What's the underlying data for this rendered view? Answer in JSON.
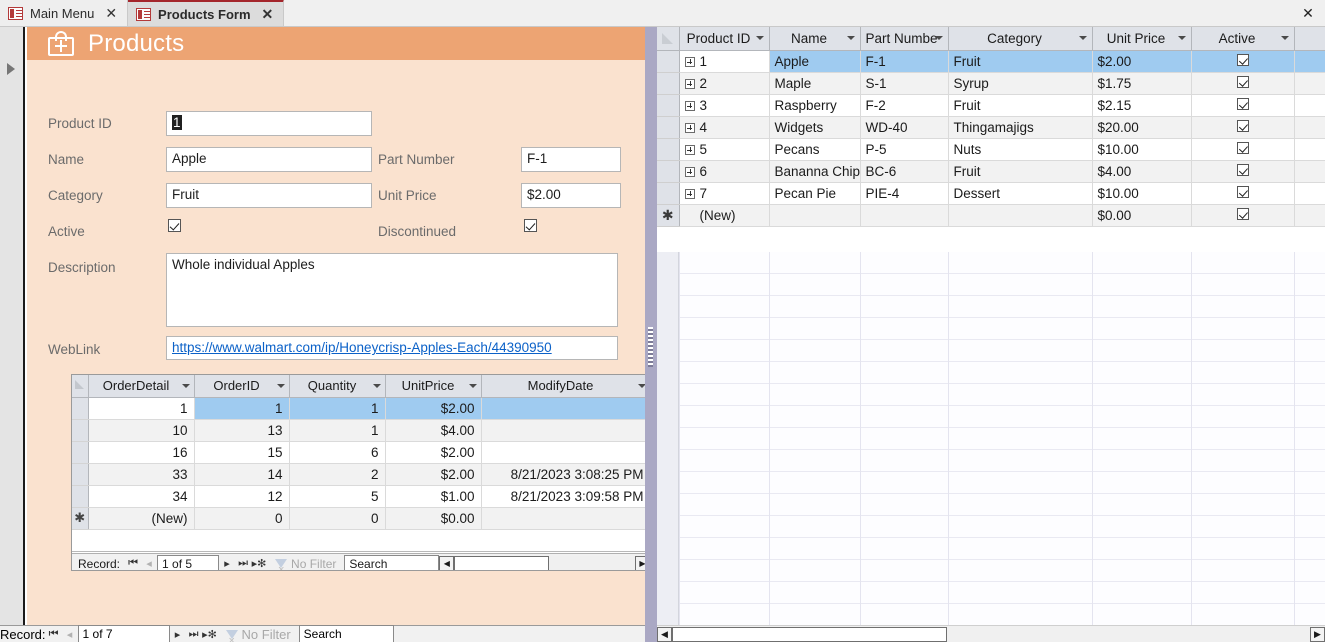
{
  "window": {
    "close_label": "✕"
  },
  "tabs": [
    {
      "label": "Main Menu",
      "close": "✕",
      "active": false
    },
    {
      "label": "Products Form",
      "close": "✕",
      "active": true
    }
  ],
  "form": {
    "title": "Products",
    "icon": "shopping-bag-plus-icon",
    "header_color": "#eda473",
    "body_color": "#fae2cf",
    "fields": {
      "product_id_label": "Product ID",
      "product_id_value": "1",
      "name_label": "Name",
      "name_value": "Apple",
      "part_number_label": "Part Number",
      "part_number_value": "F-1",
      "category_label": "Category",
      "category_value": "Fruit",
      "unit_price_label": "Unit Price",
      "unit_price_value": "$2.00",
      "active_label": "Active",
      "active_checked": true,
      "discontinued_label": "Discontinued",
      "discontinued_checked": true,
      "description_label": "Description",
      "description_value": "Whole individual Apples",
      "weblink_label": "WebLink",
      "weblink_value": "https://www.walmart.com/ip/Honeycrisp-Apples-Each/44390950"
    }
  },
  "subform": {
    "columns": [
      "OrderDetail",
      "OrderID",
      "Quantity",
      "UnitPrice",
      "ModifyDate"
    ],
    "rows": [
      {
        "OrderDetail": "1",
        "OrderID": "1",
        "Quantity": "1",
        "UnitPrice": "$2.00",
        "ModifyDate": "",
        "selected": true
      },
      {
        "OrderDetail": "10",
        "OrderID": "13",
        "Quantity": "1",
        "UnitPrice": "$4.00",
        "ModifyDate": "",
        "selected": false
      },
      {
        "OrderDetail": "16",
        "OrderID": "15",
        "Quantity": "6",
        "UnitPrice": "$2.00",
        "ModifyDate": "",
        "selected": false
      },
      {
        "OrderDetail": "33",
        "OrderID": "14",
        "Quantity": "2",
        "UnitPrice": "$2.00",
        "ModifyDate": "8/21/2023 3:08:25 PM",
        "selected": false
      },
      {
        "OrderDetail": "34",
        "OrderID": "12",
        "Quantity": "5",
        "UnitPrice": "$1.00",
        "ModifyDate": "8/21/2023 3:09:58 PM",
        "selected": false
      },
      {
        "OrderDetail": "(New)",
        "OrderID": "0",
        "Quantity": "0",
        "UnitPrice": "$0.00",
        "ModifyDate": "",
        "selected": false
      }
    ],
    "navbar": {
      "record_label": "Record:",
      "first": "⏮",
      "prev": "◂",
      "position": "1 of 5",
      "next": "▸",
      "last": "⏭",
      "new": "▸✻",
      "filter_label": "No Filter",
      "search_placeholder": "Search",
      "search_value": "Search"
    }
  },
  "datasheet": {
    "columns": [
      "Product ID",
      "Name",
      "Part Numbe",
      "Category",
      "Unit Price",
      "Active"
    ],
    "rows": [
      {
        "id": "1",
        "name": "Apple",
        "part": "F-1",
        "category": "Fruit",
        "price": "$2.00",
        "active": true,
        "selected": true,
        "expandable": true
      },
      {
        "id": "2",
        "name": "Maple",
        "part": "S-1",
        "category": "Syrup",
        "price": "$1.75",
        "active": true,
        "selected": false,
        "expandable": true
      },
      {
        "id": "3",
        "name": "Raspberry",
        "part": "F-2",
        "category": "Fruit",
        "price": "$2.15",
        "active": true,
        "selected": false,
        "expandable": true
      },
      {
        "id": "4",
        "name": "Widgets",
        "part": "WD-40",
        "category": "Thingamajigs",
        "price": "$20.00",
        "active": true,
        "selected": false,
        "expandable": true
      },
      {
        "id": "5",
        "name": "Pecans",
        "part": "P-5",
        "category": "Nuts",
        "price": "$10.00",
        "active": true,
        "selected": false,
        "expandable": true
      },
      {
        "id": "6",
        "name": "Bananna Chip",
        "part": "BC-6",
        "category": "Fruit",
        "price": "$4.00",
        "active": true,
        "selected": false,
        "expandable": true
      },
      {
        "id": "7",
        "name": "Pecan Pie",
        "part": "PIE-4",
        "category": "Dessert",
        "price": "$10.00",
        "active": true,
        "selected": false,
        "expandable": true
      },
      {
        "id": "(New)",
        "name": "",
        "part": "",
        "category": "",
        "price": "$0.00",
        "active": true,
        "selected": false,
        "expandable": false
      }
    ],
    "new_row_marker": "✱"
  },
  "form_navbar": {
    "record_label": "Record:",
    "first": "⏮",
    "prev": "◂",
    "position": "1 of 7",
    "next": "▸",
    "last": "⏭",
    "new": "▸✻",
    "filter_label": "No Filter",
    "search_value": "Search"
  },
  "scrollbars": {
    "left_arrow": "◀",
    "right_arrow": "▶"
  }
}
